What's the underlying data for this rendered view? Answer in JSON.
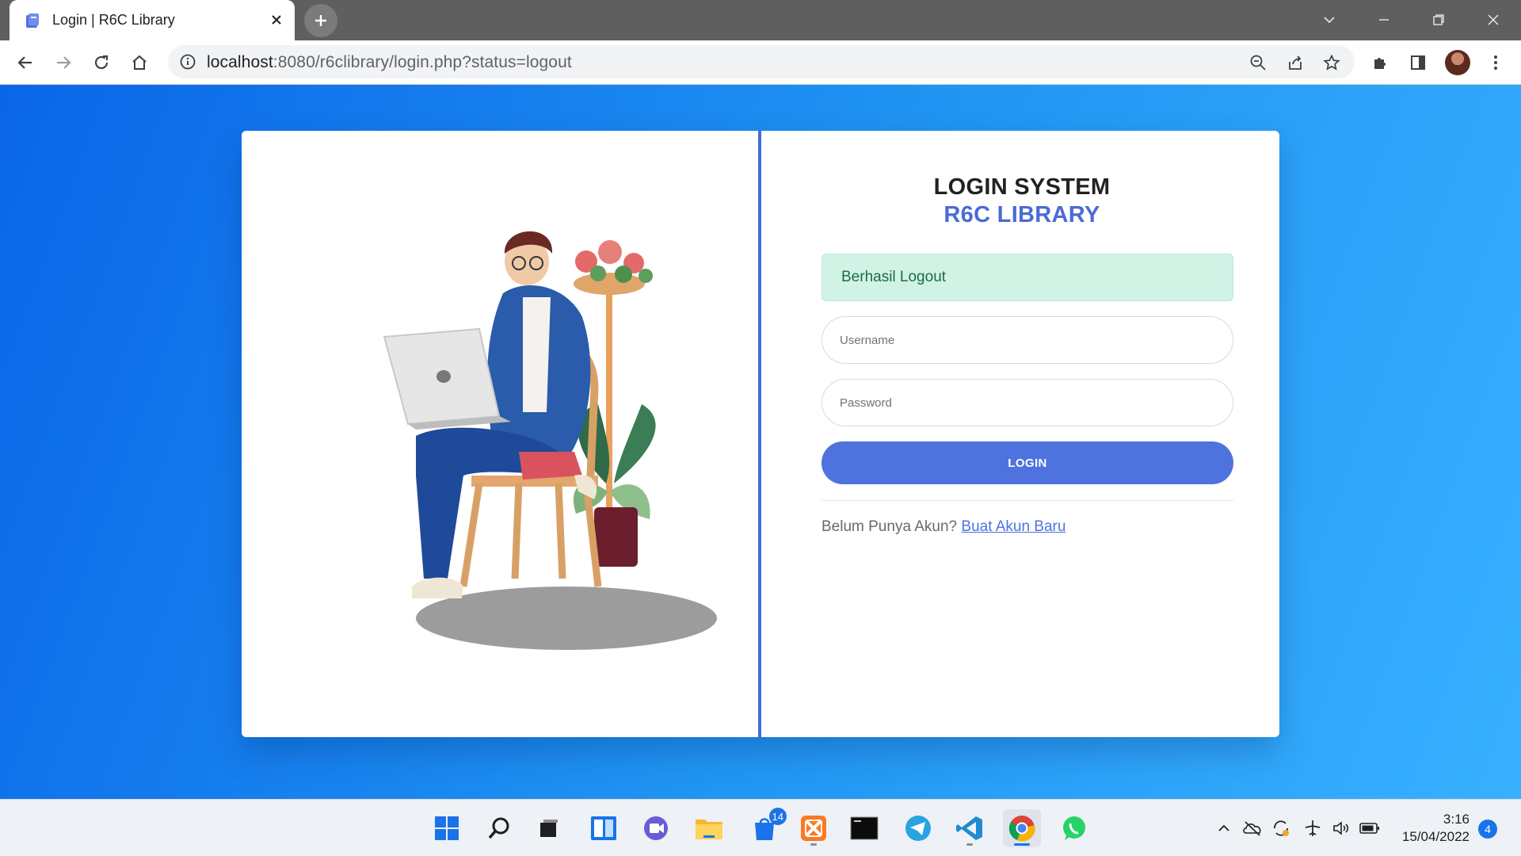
{
  "browser": {
    "tab_title": "Login | R6C Library",
    "url_host": "localhost",
    "url_path": ":8080/r6clibrary/login.php?status=logout"
  },
  "login": {
    "title": "LOGIN SYSTEM",
    "subtitle": "R6C LIBRARY",
    "alert_text": "Berhasil Logout",
    "username_placeholder": "Username",
    "password_placeholder": "Password",
    "button_label": "LOGIN",
    "register_prompt": "Belum Punya Akun?",
    "register_link": "Buat Akun Baru"
  },
  "colors": {
    "accent": "#4e73df",
    "alert_bg": "#d1f3e6",
    "page_gradient_start": "#0a66e8",
    "page_gradient_end": "#38b0ff"
  },
  "taskbar": {
    "apps": [
      "start-icon",
      "search-icon",
      "task-view-icon",
      "widgets-icon",
      "chat-icon",
      "file-explorer-icon",
      "microsoft-store-icon",
      "xampp-icon",
      "terminal-icon",
      "telegram-icon",
      "vscode-icon",
      "chrome-icon",
      "whatsapp-icon"
    ],
    "store_badge": "14",
    "time": "3:16",
    "date": "15/04/2022",
    "notification_count": "4"
  }
}
